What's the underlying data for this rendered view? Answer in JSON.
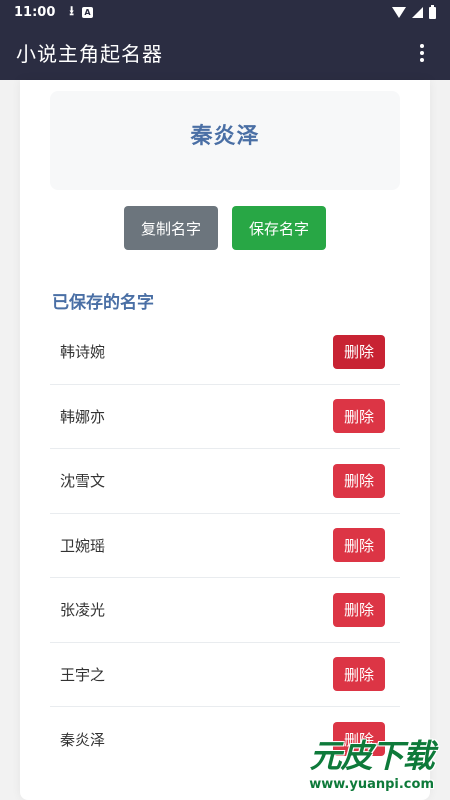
{
  "status_bar": {
    "time": "11:00",
    "icons": [
      "download-icon",
      "notification-a-icon",
      "wifi-icon",
      "signal-icon",
      "battery-icon"
    ]
  },
  "app_bar": {
    "title": "小说主角起名器",
    "menu_icon": "overflow-menu-icon"
  },
  "generated": {
    "name": "秦炎泽"
  },
  "actions": {
    "copy_label": "复制名字",
    "save_label": "保存名字"
  },
  "saved": {
    "title": "已保存的名字",
    "delete_label": "删除",
    "items": [
      {
        "name": "韩诗婉"
      },
      {
        "name": "韩娜亦"
      },
      {
        "name": "沈雪文"
      },
      {
        "name": "卫婉瑶"
      },
      {
        "name": "张凌光"
      },
      {
        "name": "王宇之"
      },
      {
        "name": "秦炎泽"
      }
    ]
  },
  "watermark": {
    "brand": "元皮下载",
    "url": "www.yuanpi.com"
  },
  "colors": {
    "app_bar": "#2b2d42",
    "accent": "#4a6fa5",
    "copy_button": "#6c757d",
    "save_button": "#28a745",
    "delete_button": "#dc3545"
  }
}
